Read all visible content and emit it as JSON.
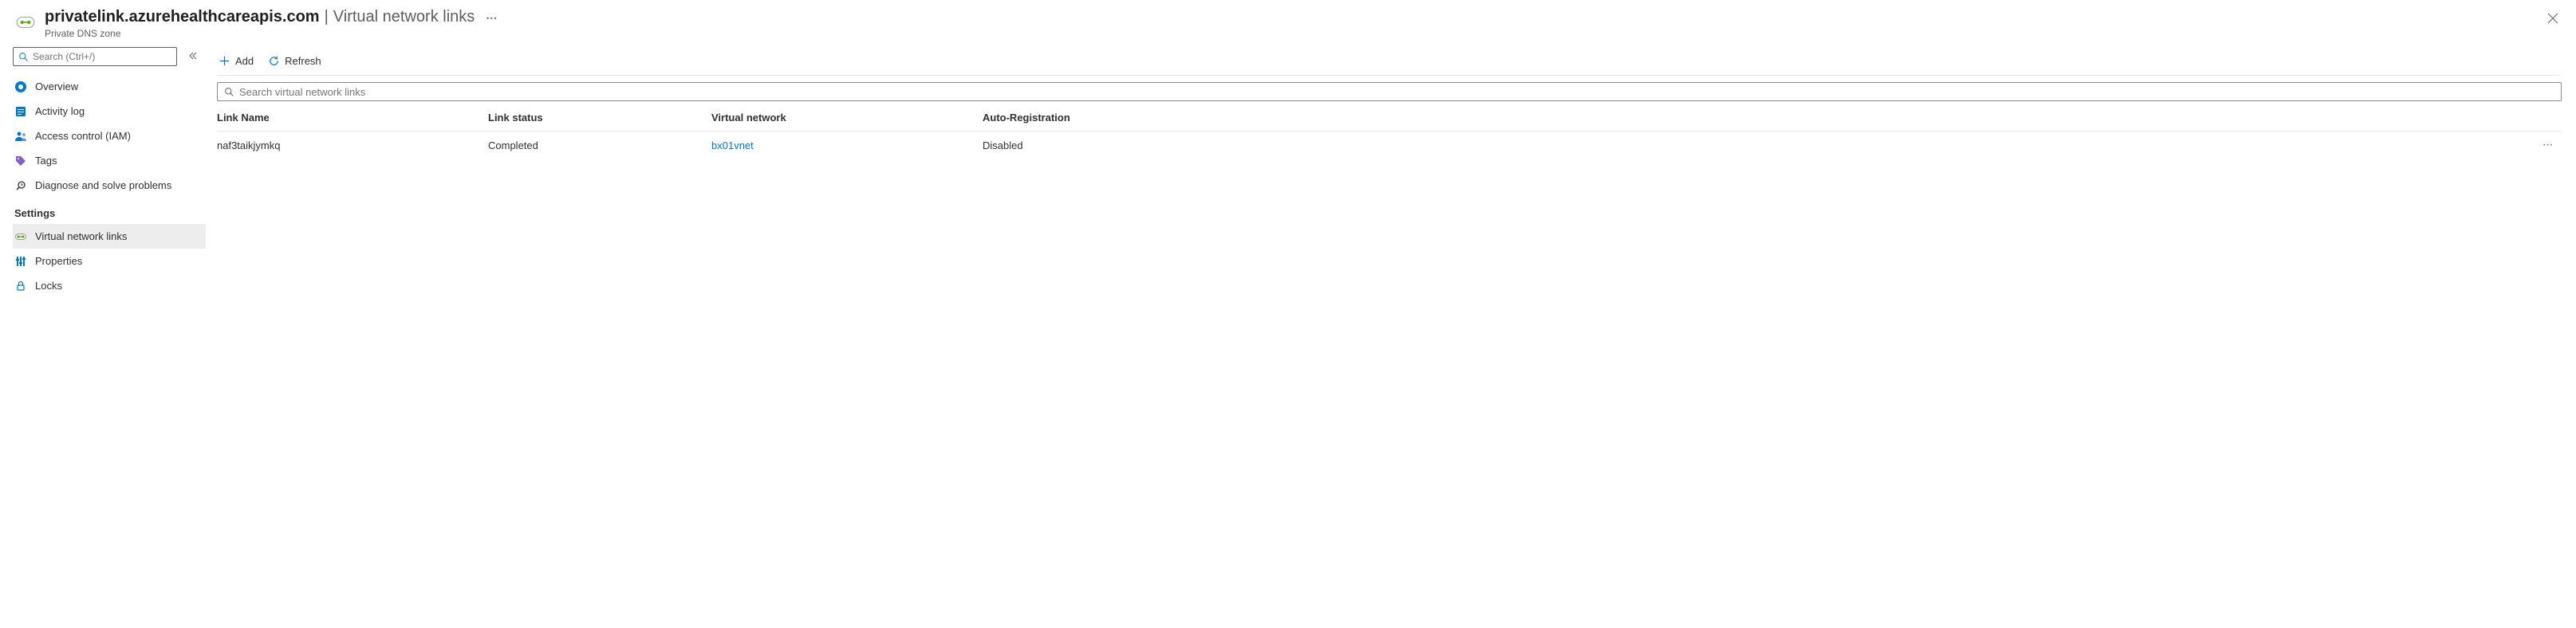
{
  "header": {
    "resource_name": "privatelink.azurehealthcareapis.com",
    "section": "Virtual network links",
    "subtitle": "Private DNS zone",
    "more": "⋯"
  },
  "sidebar": {
    "search_placeholder": "Search (Ctrl+/)",
    "items_top": [
      {
        "id": "overview",
        "label": "Overview"
      },
      {
        "id": "activity-log",
        "label": "Activity log"
      },
      {
        "id": "access-control",
        "label": "Access control (IAM)"
      },
      {
        "id": "tags",
        "label": "Tags"
      },
      {
        "id": "diagnose",
        "label": "Diagnose and solve problems"
      }
    ],
    "settings_label": "Settings",
    "items_settings": [
      {
        "id": "virtual-network-links",
        "label": "Virtual network links",
        "active": true
      },
      {
        "id": "properties",
        "label": "Properties"
      },
      {
        "id": "locks",
        "label": "Locks"
      }
    ]
  },
  "toolbar": {
    "add_label": "Add",
    "refresh_label": "Refresh"
  },
  "main_search_placeholder": "Search virtual network links",
  "table": {
    "headers": {
      "name": "Link Name",
      "status": "Link status",
      "vnet": "Virtual network",
      "auto": "Auto-Registration"
    },
    "rows": [
      {
        "name": "naf3taikjymkq",
        "status": "Completed",
        "vnet": "bx01vnet",
        "auto": "Disabled"
      }
    ]
  }
}
